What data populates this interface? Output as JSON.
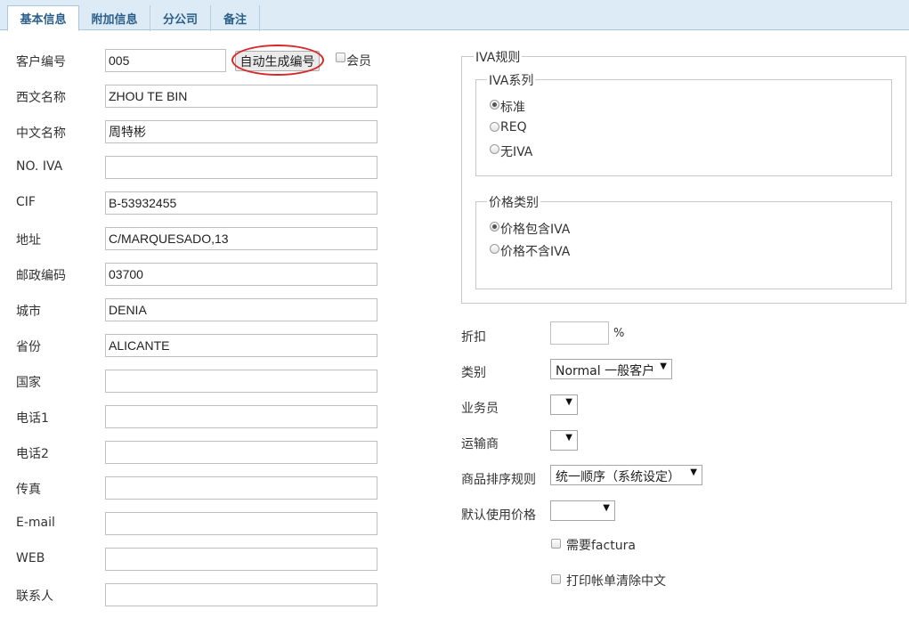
{
  "tabs": [
    {
      "label": "基本信息"
    },
    {
      "label": "附加信息"
    },
    {
      "label": "分公司"
    },
    {
      "label": "备注"
    }
  ],
  "left_form": {
    "customer_no": {
      "label": "客户编号",
      "value": "005"
    },
    "generate_button": "自动生成编号",
    "member_label": "会员",
    "fields": [
      {
        "label": "西文名称",
        "value": "ZHOU TE BIN"
      },
      {
        "label": "中文名称",
        "value": "周特彬"
      },
      {
        "label": "NO. IVA",
        "value": ""
      },
      {
        "label": "CIF",
        "value": "B-53932455"
      },
      {
        "label": "地址",
        "value": "C/MARQUESADO,13"
      },
      {
        "label": "邮政编码",
        "value": "03700"
      },
      {
        "label": "城市",
        "value": "DENIA"
      },
      {
        "label": "省份",
        "value": "ALICANTE"
      },
      {
        "label": "国家",
        "value": ""
      },
      {
        "label": "电话1",
        "value": ""
      },
      {
        "label": "电话2",
        "value": ""
      },
      {
        "label": "传真",
        "value": ""
      },
      {
        "label": "E-mail",
        "value": ""
      },
      {
        "label": "WEB",
        "value": ""
      },
      {
        "label": "联系人",
        "value": ""
      }
    ]
  },
  "iva_rules": {
    "legend": "IVA规则",
    "series": {
      "legend": "IVA系列",
      "options": [
        {
          "label": "标准",
          "checked": true
        },
        {
          "label": "REQ",
          "checked": false
        },
        {
          "label": "无IVA",
          "checked": false
        }
      ]
    },
    "price_type": {
      "legend": "价格类别",
      "options": [
        {
          "label": "价格包含IVA",
          "checked": true
        },
        {
          "label": "价格不含IVA",
          "checked": false
        }
      ]
    }
  },
  "right_form": {
    "discount": {
      "label": "折扣",
      "value": "",
      "unit": "%"
    },
    "category": {
      "label": "类别",
      "value": "Normal 一般客户"
    },
    "salesman": {
      "label": "业务员",
      "value": ""
    },
    "carrier": {
      "label": "运输商",
      "value": ""
    },
    "sort_rule": {
      "label": "商品排序规则",
      "value": "统一顺序（系统设定）"
    },
    "default_price": {
      "label": "默认使用价格",
      "value": ""
    },
    "need_factura": {
      "label": "需要factura",
      "checked": false
    },
    "print_clear_chinese": {
      "label": "打印帐单清除中文",
      "checked": false
    }
  },
  "icons": {
    "dropdown": "dropdown-arrow-icon"
  },
  "colors": {
    "tab_text": "#2b5f8a",
    "highlight_ring": "#d8262b",
    "tab_bar": "#dcebf5"
  }
}
